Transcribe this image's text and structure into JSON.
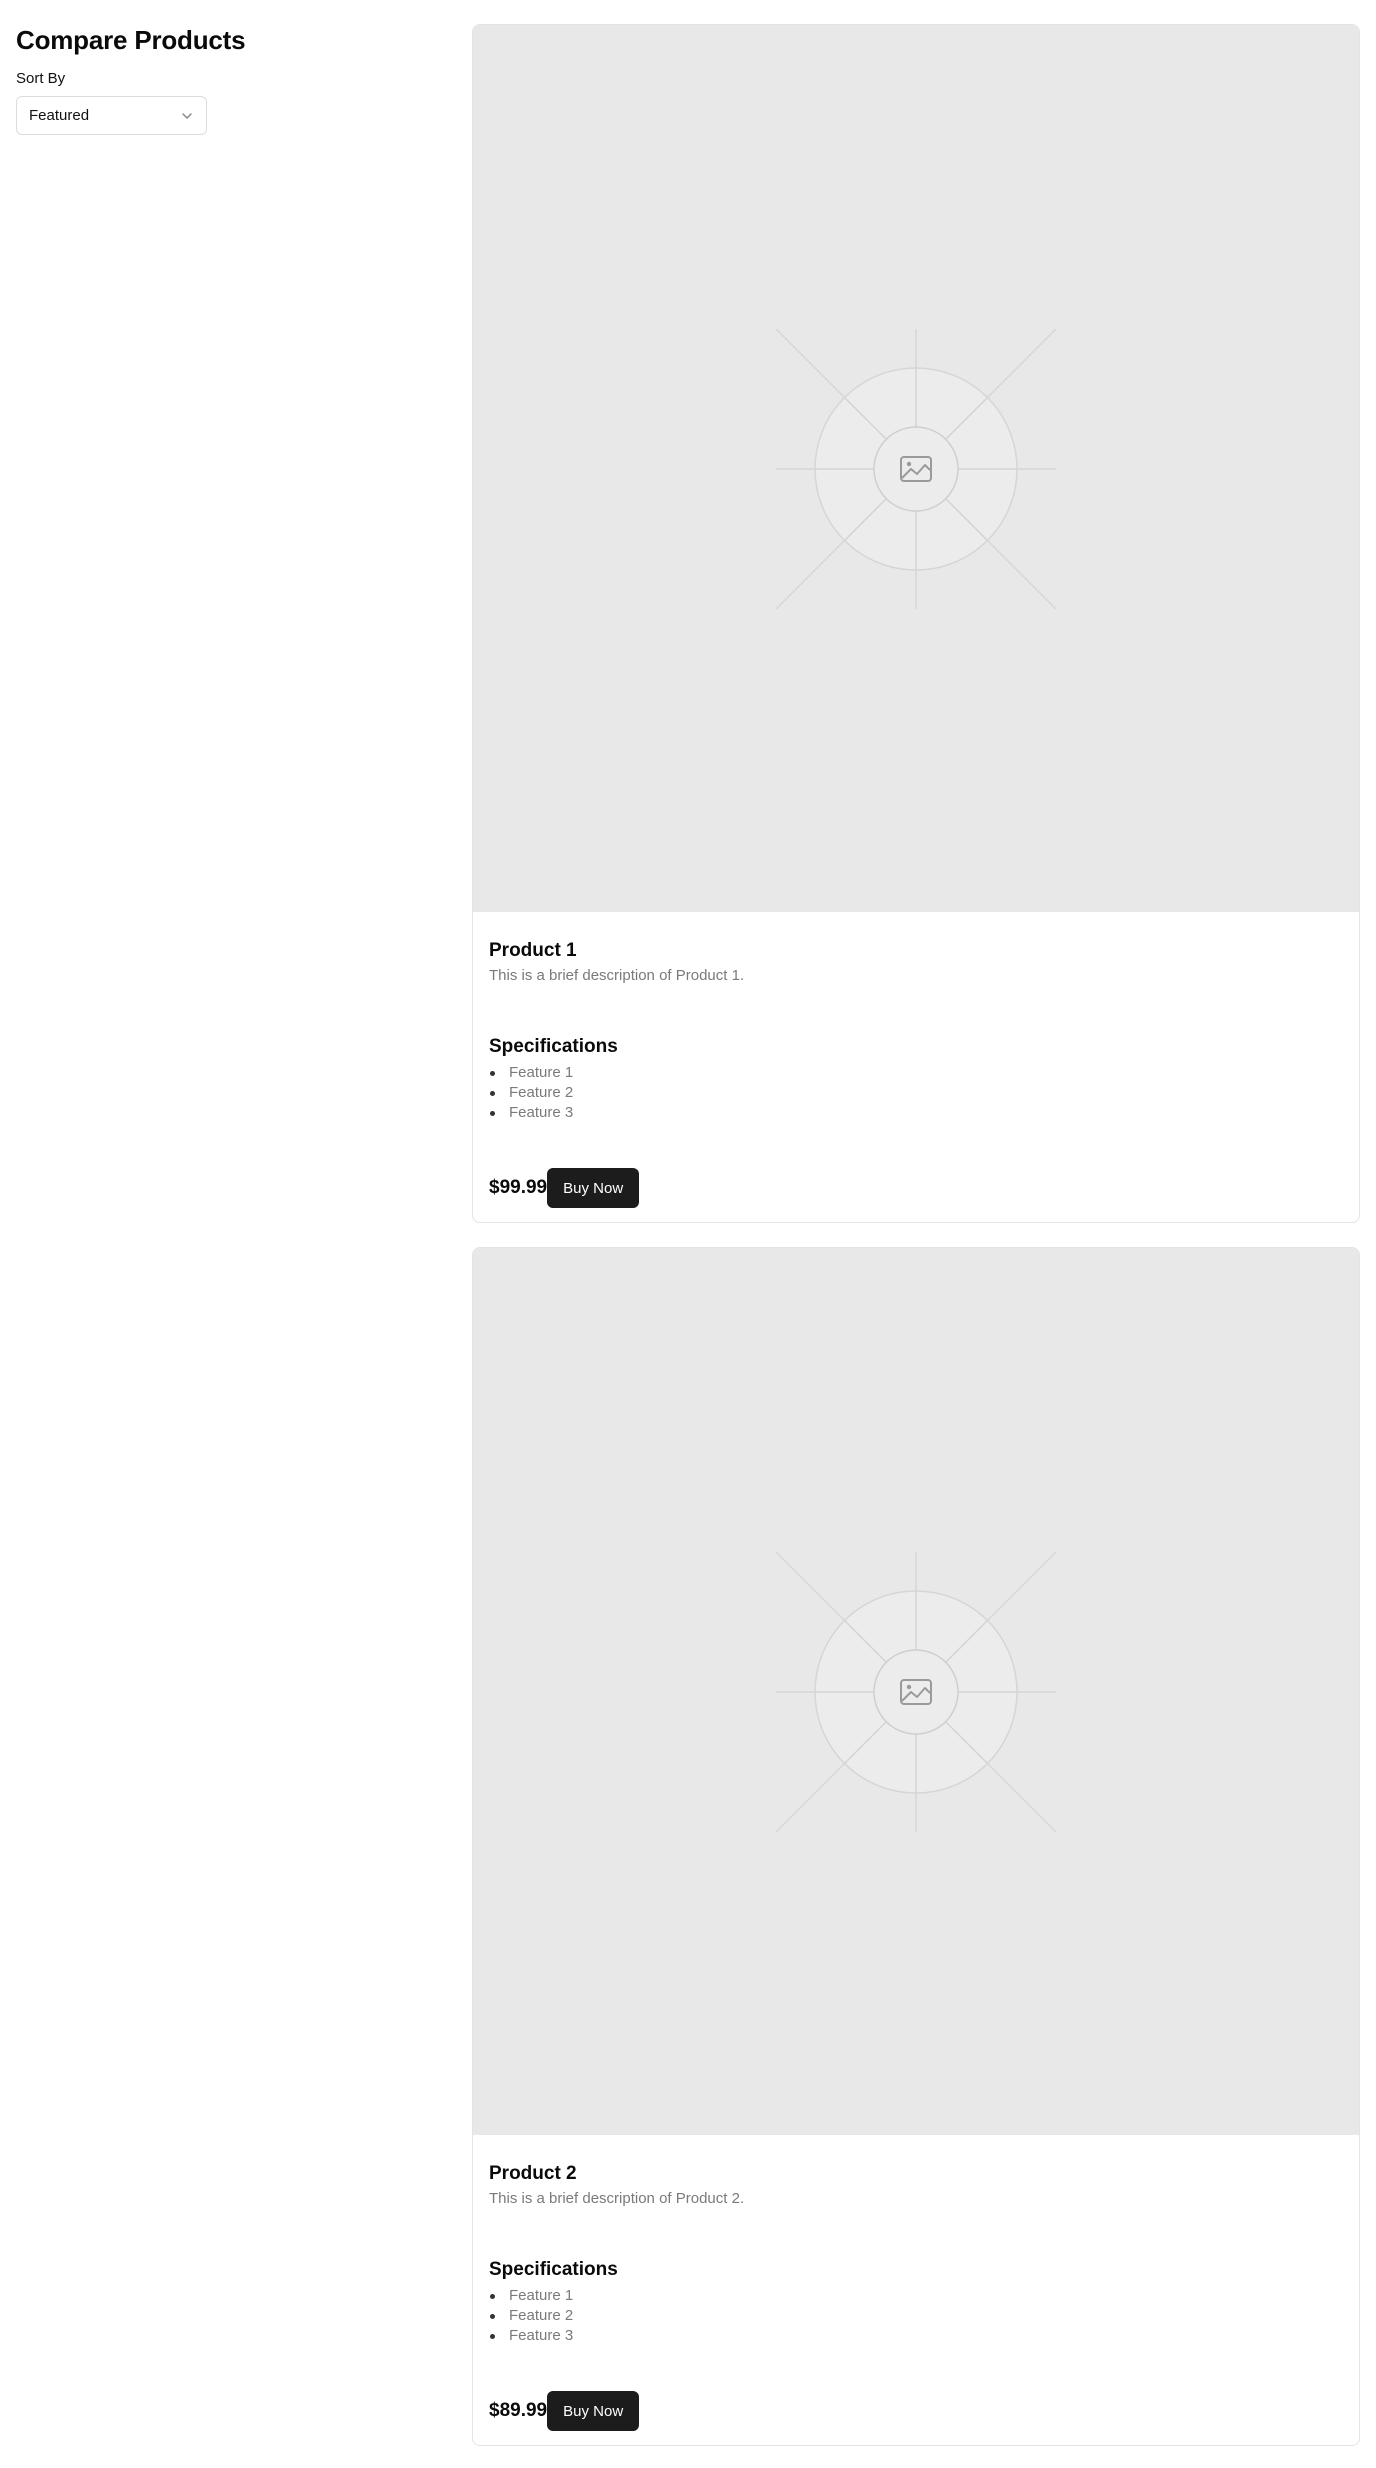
{
  "header": {
    "title": "Compare Products"
  },
  "sort": {
    "label": "Sort By",
    "selected": "Featured",
    "icon": "chevron-down-icon"
  },
  "products": [
    {
      "name": "Product 1",
      "description": "This is a brief description of Product 1.",
      "specs_title": "Specifications",
      "features": [
        "Feature 1",
        "Feature 2",
        "Feature 3"
      ],
      "price": "$99.99",
      "button_label": "Buy Now",
      "image_icon": "image-placeholder-icon"
    },
    {
      "name": "Product 2",
      "description": "This is a brief description of Product 2.",
      "specs_title": "Specifications",
      "features": [
        "Feature 1",
        "Feature 2",
        "Feature 3"
      ],
      "price": "$89.99",
      "button_label": "Buy Now",
      "image_icon": "image-placeholder-icon"
    }
  ],
  "colors": {
    "button_bg": "#1c1c1c",
    "image_bg": "#e8e8e8",
    "muted_text": "#7a7a7a"
  }
}
